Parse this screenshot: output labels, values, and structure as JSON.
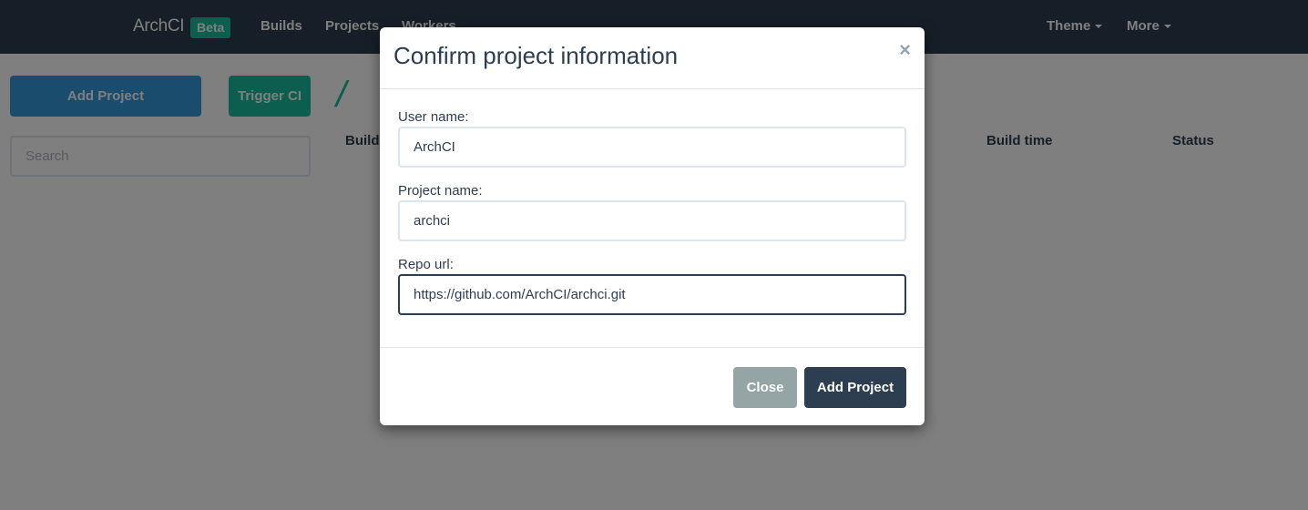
{
  "navbar": {
    "brand": "ArchCI",
    "badge": "Beta",
    "links": [
      "Builds",
      "Projects",
      "Workers"
    ],
    "theme": "Theme",
    "more": "More"
  },
  "toolbar": {
    "add_project": "Add Project",
    "trigger_ci": "Trigger CI",
    "breadcrumb": "/"
  },
  "search": {
    "placeholder": "Search"
  },
  "table": {
    "headers": [
      "Build",
      "Build time",
      "Status"
    ]
  },
  "modal": {
    "title": "Confirm project information",
    "close_glyph": "×",
    "fields": [
      {
        "label": "User name:",
        "value": "ArchCI"
      },
      {
        "label": "Project name:",
        "value": "archci"
      },
      {
        "label": "Repo url:",
        "value": "https://github.com/ArchCI/archci.git"
      }
    ],
    "close_button": "Close",
    "submit_button": "Add Project"
  },
  "colors": {
    "navbar": "#2c3e50",
    "primary": "#3498db",
    "success": "#18bc9c",
    "default": "#95a5a6"
  }
}
